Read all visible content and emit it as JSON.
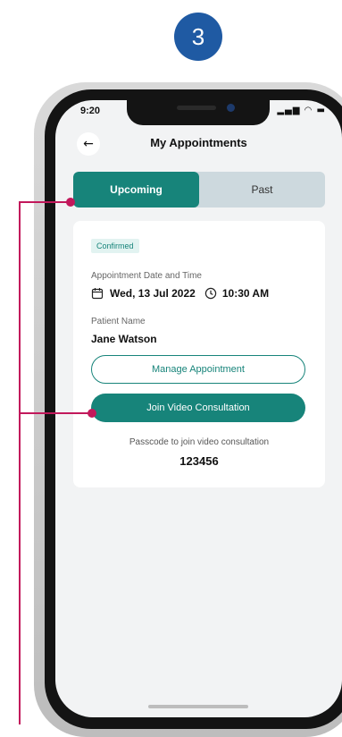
{
  "step": "3",
  "status_bar": {
    "time": "9:20",
    "icons": "signal-wifi-battery"
  },
  "header": {
    "title": "My Appointments",
    "back_icon": "arrow-left-icon"
  },
  "tabs": [
    {
      "label": "Upcoming",
      "active": true
    },
    {
      "label": "Past",
      "active": false
    }
  ],
  "card": {
    "status_badge": "Confirmed",
    "date_label": "Appointment Date and Time",
    "date": "Wed, 13 Jul 2022",
    "time": "10:30 AM",
    "patient_label": "Patient Name",
    "patient_name": "Jane Watson",
    "manage_button": "Manage Appointment",
    "join_button": "Join Video Consultation",
    "passcode_label": "Passcode to join video consultation",
    "passcode": "123456"
  },
  "colors": {
    "primary": "#17847a",
    "callout": "#c2185b",
    "step_badge": "#1f5aa3"
  }
}
